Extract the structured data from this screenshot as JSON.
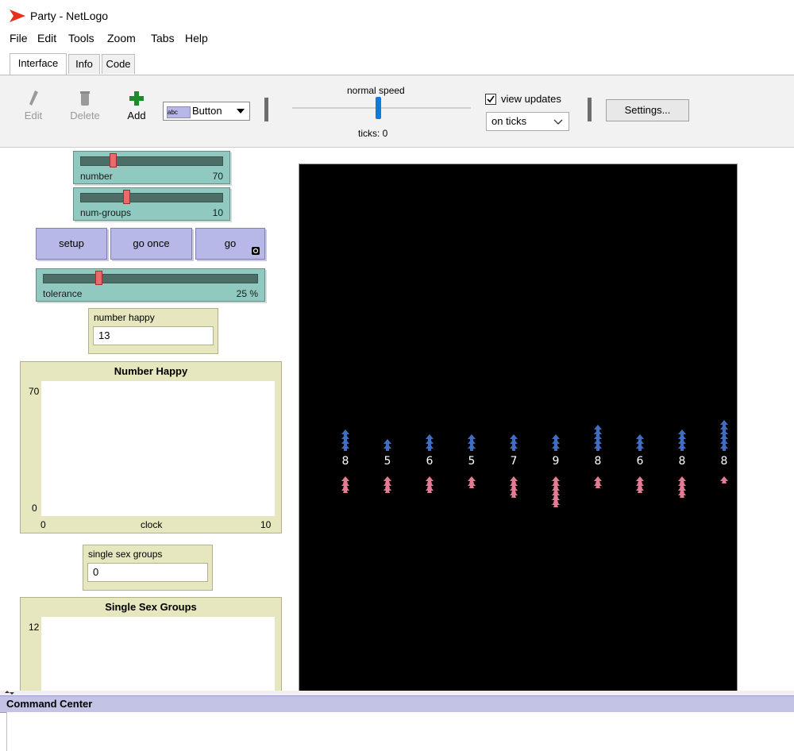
{
  "window": {
    "title": "Party - NetLogo"
  },
  "menu": {
    "items": [
      "File",
      "Edit",
      "Tools",
      "Zoom",
      "Tabs",
      "Help"
    ]
  },
  "tabs": [
    {
      "label": "Interface",
      "active": true
    },
    {
      "label": "Info",
      "active": false
    },
    {
      "label": "Code",
      "active": false
    }
  ],
  "toolbar": {
    "edit": "Edit",
    "delete": "Delete",
    "add": "Add",
    "widget_type": "Button",
    "widget_chip": "abc",
    "speed_label": "normal speed",
    "ticks": "ticks: 0",
    "view_updates": "view updates",
    "view_updates_checked": true,
    "update_mode": "on ticks",
    "settings": "Settings..."
  },
  "sliders": [
    {
      "label": "number",
      "value": "70",
      "level": 0.25
    },
    {
      "label": "num-groups",
      "value": "10",
      "level": 0.32
    },
    {
      "label": "tolerance",
      "value": "25 %",
      "level": 0.25
    }
  ],
  "buttons": {
    "setup": "setup",
    "go_once": "go once",
    "go": "go"
  },
  "monitors": {
    "number_happy": {
      "label": "number happy",
      "value": "13"
    },
    "single_sex": {
      "label": "single sex groups",
      "value": "0"
    }
  },
  "plots": {
    "number_happy": {
      "title": "Number Happy",
      "ymax": "70",
      "ymin": "0",
      "xmin": "0",
      "xmax": "10",
      "xlabel": "clock"
    },
    "single_sex": {
      "title": "Single Sex Groups",
      "ymax": "12"
    }
  },
  "world": {
    "colors": {
      "men": "#3f6ec0",
      "women": "#e27c95",
      "label": "#ffffff"
    },
    "groups": [
      {
        "count": "8",
        "men": 4,
        "women": 3
      },
      {
        "count": "5",
        "men": 2,
        "women": 3
      },
      {
        "count": "6",
        "men": 3,
        "women": 3
      },
      {
        "count": "5",
        "men": 3,
        "women": 2
      },
      {
        "count": "7",
        "men": 3,
        "women": 4
      },
      {
        "count": "9",
        "men": 3,
        "women": 6
      },
      {
        "count": "8",
        "men": 5,
        "women": 2
      },
      {
        "count": "6",
        "men": 3,
        "women": 3
      },
      {
        "count": "8",
        "men": 4,
        "women": 4
      },
      {
        "count": "8",
        "men": 6,
        "women": 1
      }
    ]
  },
  "command_center": {
    "title": "Command Center"
  }
}
